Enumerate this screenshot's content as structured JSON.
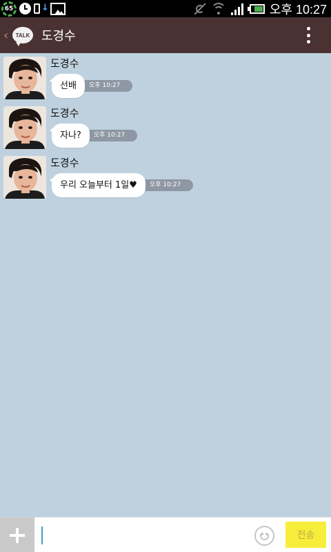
{
  "status_bar": {
    "battery_percent_label": "65",
    "time": "오후 10:27",
    "icons": [
      "battery-ring-icon",
      "clock-icon",
      "download-icon",
      "image-icon",
      "sync-off-icon",
      "wifi-icon",
      "signal-icon",
      "battery-icon"
    ]
  },
  "header": {
    "logo_text": "TALK",
    "title": "도경수",
    "back_icon": "chevron-left-icon",
    "menu_icon": "more-vert-icon",
    "background": "#4a3233"
  },
  "chat": {
    "background": "#bfd1de",
    "messages": [
      {
        "sender": "도경수",
        "text": "선배",
        "time": "오후 10:27"
      },
      {
        "sender": "도경수",
        "text": "자나?",
        "time": "오후 10:27"
      },
      {
        "sender": "도경수",
        "text": "우리 오늘부터 1일",
        "suffix": "♥",
        "time": "오후 10:27"
      }
    ]
  },
  "input_bar": {
    "plus_icon": "plus-icon",
    "value": "",
    "emoji_icon": "smiley-icon",
    "send_label": "전송",
    "send_color": "#f7ee3b"
  }
}
